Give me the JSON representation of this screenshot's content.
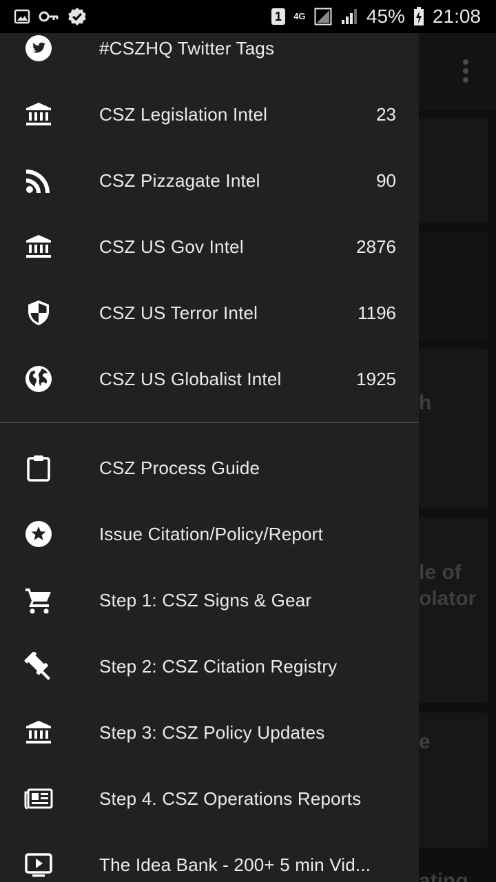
{
  "status_bar": {
    "battery": "45%",
    "time": "21:08",
    "sim_badge": "1",
    "network": "4G"
  },
  "background": {
    "snippets": [
      "h",
      "le of",
      "olator",
      "e",
      "ating"
    ]
  },
  "drawer": {
    "feeds": [
      {
        "label": "#CSZHQ Twitter Tags",
        "count": "",
        "icon": "twitter-icon"
      },
      {
        "label": "CSZ Legislation Intel",
        "count": "23",
        "icon": "bank-icon"
      },
      {
        "label": "CSZ Pizzagate Intel",
        "count": "90",
        "icon": "rss-icon"
      },
      {
        "label": "CSZ US Gov Intel",
        "count": "2876",
        "icon": "bank-icon"
      },
      {
        "label": "CSZ US Terror Intel",
        "count": "1196",
        "icon": "shield-icon"
      },
      {
        "label": "CSZ US Globalist Intel",
        "count": "1925",
        "icon": "globe-icon"
      }
    ],
    "links": [
      {
        "label": "CSZ Process Guide",
        "icon": "clipboard-icon"
      },
      {
        "label": "Issue Citation/Policy/Report",
        "icon": "star-circle-icon"
      },
      {
        "label": "Step 1: CSZ Signs & Gear",
        "icon": "cart-icon"
      },
      {
        "label": "Step 2: CSZ Citation Registry",
        "icon": "gavel-icon"
      },
      {
        "label": "Step 3: CSZ Policy Updates",
        "icon": "bank-icon"
      },
      {
        "label": "Step 4. CSZ Operations Reports",
        "icon": "newspaper-icon"
      },
      {
        "label": "The Idea Bank - 200+ 5 min Vid...",
        "icon": "video-icon"
      }
    ]
  },
  "colors": {
    "drawer_bg": "#212121",
    "text": "#ececec",
    "status_bar_bg": "#000000"
  }
}
